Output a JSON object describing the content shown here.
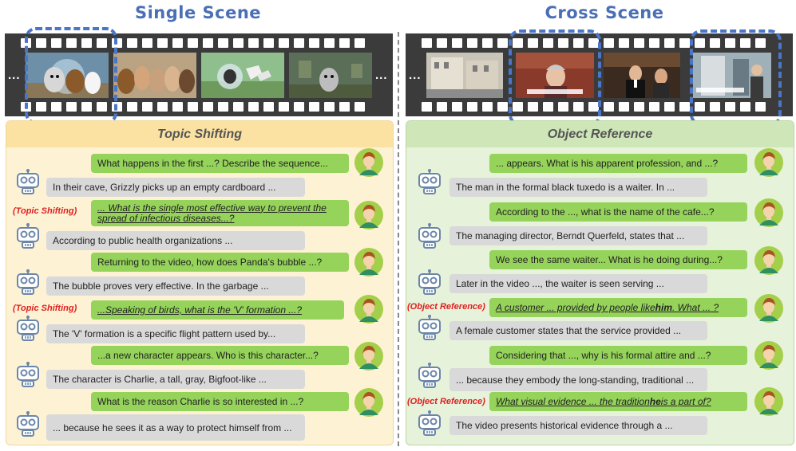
{
  "titles": {
    "left": "Single Scene",
    "right": "Cross Scene"
  },
  "film": {
    "ellipsis": "..."
  },
  "left": {
    "header": "Topic Shifting",
    "tag": "(Topic Shifting)",
    "messages": [
      {
        "user": "What happens in the first ...? Describe the sequence...",
        "bot": "In their cave, Grizzly picks up an empty cardboard  ..."
      },
      {
        "user": "... What is the single most effective way to prevent the spread of infectious diseases...?",
        "bot": "According to public health organizations ..."
      },
      {
        "user": "Returning to the video, how does Panda's bubble ...?",
        "bot": "The bubble proves very effective. In the garbage ..."
      },
      {
        "user": "...Speaking of birds, what is the 'V' formation ...?",
        "bot": "The 'V' formation is a specific flight pattern used by..."
      },
      {
        "user": "...a new character appears. Who is this character...?",
        "bot": "The character is Charlie, a tall, gray, Bigfoot-like ..."
      },
      {
        "user": "What is the reason Charlie is so interested in ...?",
        "bot": "... because he sees it as a way to protect himself from ..."
      }
    ]
  },
  "right": {
    "header": "Object Reference",
    "tag": "(Object Reference)",
    "messages": [
      {
        "user": "... appears. What is his apparent profession, and ...?",
        "bot": "The man in the formal black tuxedo is a waiter. In ..."
      },
      {
        "user": "According to the ..., what is the name of the cafe...?",
        "bot": "The managing director, Berndt Querfeld, states that ..."
      },
      {
        "user": "We see the same waiter... What is he doing during...?",
        "bot": "Later in the video ..., the waiter is seen serving ..."
      },
      {
        "user_pre": "A customer ... provided by people like ",
        "user_bold": "him",
        "user_post": ". What ... ?",
        "bot": "A female customer states that the service provided ..."
      },
      {
        "user": "Considering that ..., why is his formal attire and ...?",
        "bot": "... because they embody the long-standing, traditional ..."
      },
      {
        "user_pre": "What visual evidence ... the tradition ",
        "user_bold": "he",
        "user_post": " is a part of?",
        "bot": "The video presents historical evidence through a ..."
      }
    ]
  }
}
